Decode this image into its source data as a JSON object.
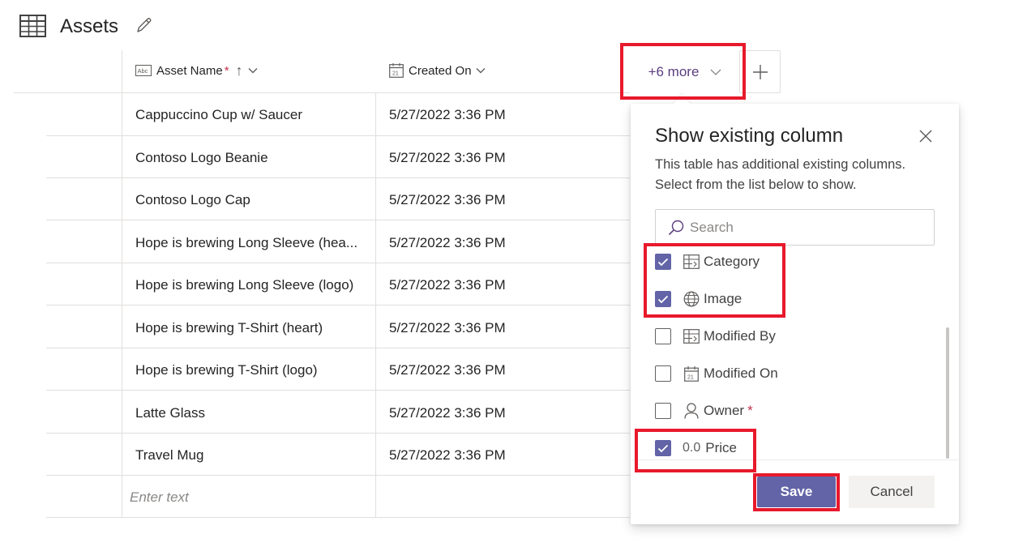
{
  "page": {
    "title": "Assets"
  },
  "columns": {
    "asset_name": "Asset Name",
    "required_marker": "*",
    "sort_arrow": "↑",
    "created_on": "Created On",
    "more": "+6 more"
  },
  "rows": [
    {
      "name": "Cappuccino Cup w/ Saucer",
      "created": "5/27/2022 3:36 PM"
    },
    {
      "name": "Contoso Logo Beanie",
      "created": "5/27/2022 3:36 PM"
    },
    {
      "name": "Contoso Logo Cap",
      "created": "5/27/2022 3:36 PM"
    },
    {
      "name": "Hope is brewing Long Sleeve (hea...",
      "created": "5/27/2022 3:36 PM"
    },
    {
      "name": "Hope is brewing Long Sleeve (logo)",
      "created": "5/27/2022 3:36 PM"
    },
    {
      "name": "Hope is brewing T-Shirt (heart)",
      "created": "5/27/2022 3:36 PM"
    },
    {
      "name": "Hope is brewing T-Shirt (logo)",
      "created": "5/27/2022 3:36 PM"
    },
    {
      "name": "Latte Glass",
      "created": "5/27/2022 3:36 PM"
    },
    {
      "name": "Travel Mug",
      "created": "5/27/2022 3:36 PM"
    }
  ],
  "new_row": {
    "placeholder": "Enter text"
  },
  "popover": {
    "title": "Show existing column",
    "description": "This table has additional existing columns. Select from the list below to show.",
    "search_placeholder": "Search",
    "options": [
      {
        "label": "Category",
        "checked": true,
        "icon": "lookup-icon",
        "required": false
      },
      {
        "label": "Image",
        "checked": true,
        "icon": "globe-icon",
        "required": false
      },
      {
        "label": "Modified By",
        "checked": false,
        "icon": "lookup-icon",
        "required": false
      },
      {
        "label": "Modified On",
        "checked": false,
        "icon": "calendar-icon",
        "required": false
      },
      {
        "label": "Owner",
        "checked": false,
        "icon": "person-icon",
        "required": true
      },
      {
        "label": "Price",
        "checked": true,
        "icon": "decimal-icon",
        "decimal_glyph": "0.0",
        "required": false
      }
    ],
    "save_label": "Save",
    "cancel_label": "Cancel"
  },
  "colors": {
    "accent": "#6264a7",
    "link_purple": "#5b3e7e",
    "highlight_red": "#e8192c",
    "required_red": "#c4314b"
  }
}
